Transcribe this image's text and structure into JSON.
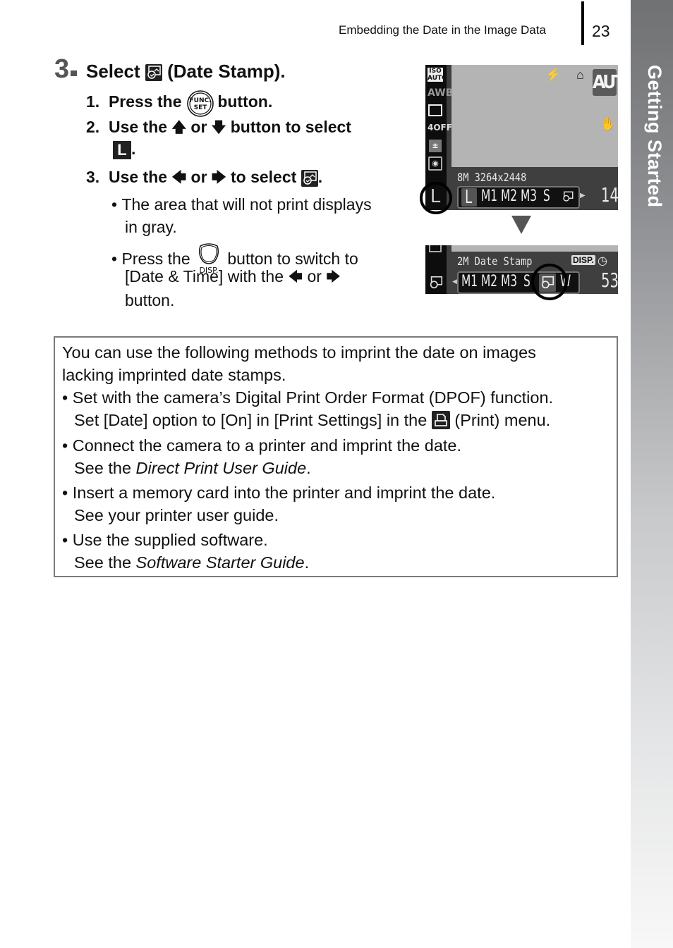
{
  "header": {
    "section_title": "Embedding the Date in the Image Data",
    "page_number": "23"
  },
  "side_tab": {
    "label": "Getting Started"
  },
  "step": {
    "number": "3",
    "title_prefix": "Select",
    "title_icon": "date-stamp-icon",
    "title_suffix": "(Date Stamp).",
    "substeps": [
      {
        "num": "1.",
        "pre": "Press the",
        "icon": "func-set-button-icon",
        "post": "button."
      },
      {
        "num": "2.",
        "pre": "Use the",
        "icon1": "up-arrow-icon",
        "mid": "or",
        "icon2": "down-arrow-icon",
        "post": "button to select",
        "icon3": "large-size-L-icon",
        "end": "."
      },
      {
        "num": "3.",
        "pre": "Use the",
        "icon1": "left-arrow-icon",
        "mid": "or",
        "icon2": "right-arrow-icon",
        "post": "to select",
        "icon3": "date-stamp-icon",
        "end": "."
      }
    ],
    "bullets": [
      {
        "line1": "The area that will not print displays",
        "line2": "in gray."
      },
      {
        "pre": "Press the",
        "icon": "disp-button-icon",
        "icon_caption": "DISP.",
        "post": "button to switch to",
        "line2_pre": "[Date & Time] with the",
        "line2_mid": "or",
        "line3": "button."
      }
    ]
  },
  "screen1": {
    "left_icons": [
      "ISO AUTO",
      "AWB",
      "drive-single",
      "red-eye OFF",
      "flash-comp",
      "metering",
      "L"
    ],
    "auto_badge": "AUTO",
    "resolution": "8M 3264x2448",
    "size_options": [
      "L",
      "M1",
      "M2",
      "M3",
      "S",
      "date-stamp"
    ],
    "selected": "L",
    "shots_remaining": "14"
  },
  "screen2": {
    "label": "2M Date Stamp",
    "disp_badge": "DISP.",
    "size_options": [
      "M1",
      "M2",
      "M3",
      "S",
      "date-stamp",
      "W"
    ],
    "selected": "date-stamp",
    "shots_remaining": "53"
  },
  "note": {
    "intro_line1": "You can use the following methods to imprint the date on images",
    "intro_line2": "lacking imprinted date stamps.",
    "items": [
      {
        "line1": "Set with the camera’s Digital Print Order Format (DPOF) function.",
        "line2_pre": "Set [Date] option to [On] in [Print Settings] in the",
        "line2_icon": "print-menu-icon",
        "line2_post": "(Print) menu."
      },
      {
        "line1": "Connect the camera to a printer and imprint the date.",
        "line2_pre": "See the ",
        "line2_italic": "Direct Print User Guide",
        "line2_post": "."
      },
      {
        "line1": "Insert a memory card into the printer and imprint the date.",
        "line2": "See your printer user guide."
      },
      {
        "line1": "Use the supplied software.",
        "line2_pre": "See the ",
        "line2_italic": "Software Starter Guide",
        "line2_post": "."
      }
    ]
  }
}
